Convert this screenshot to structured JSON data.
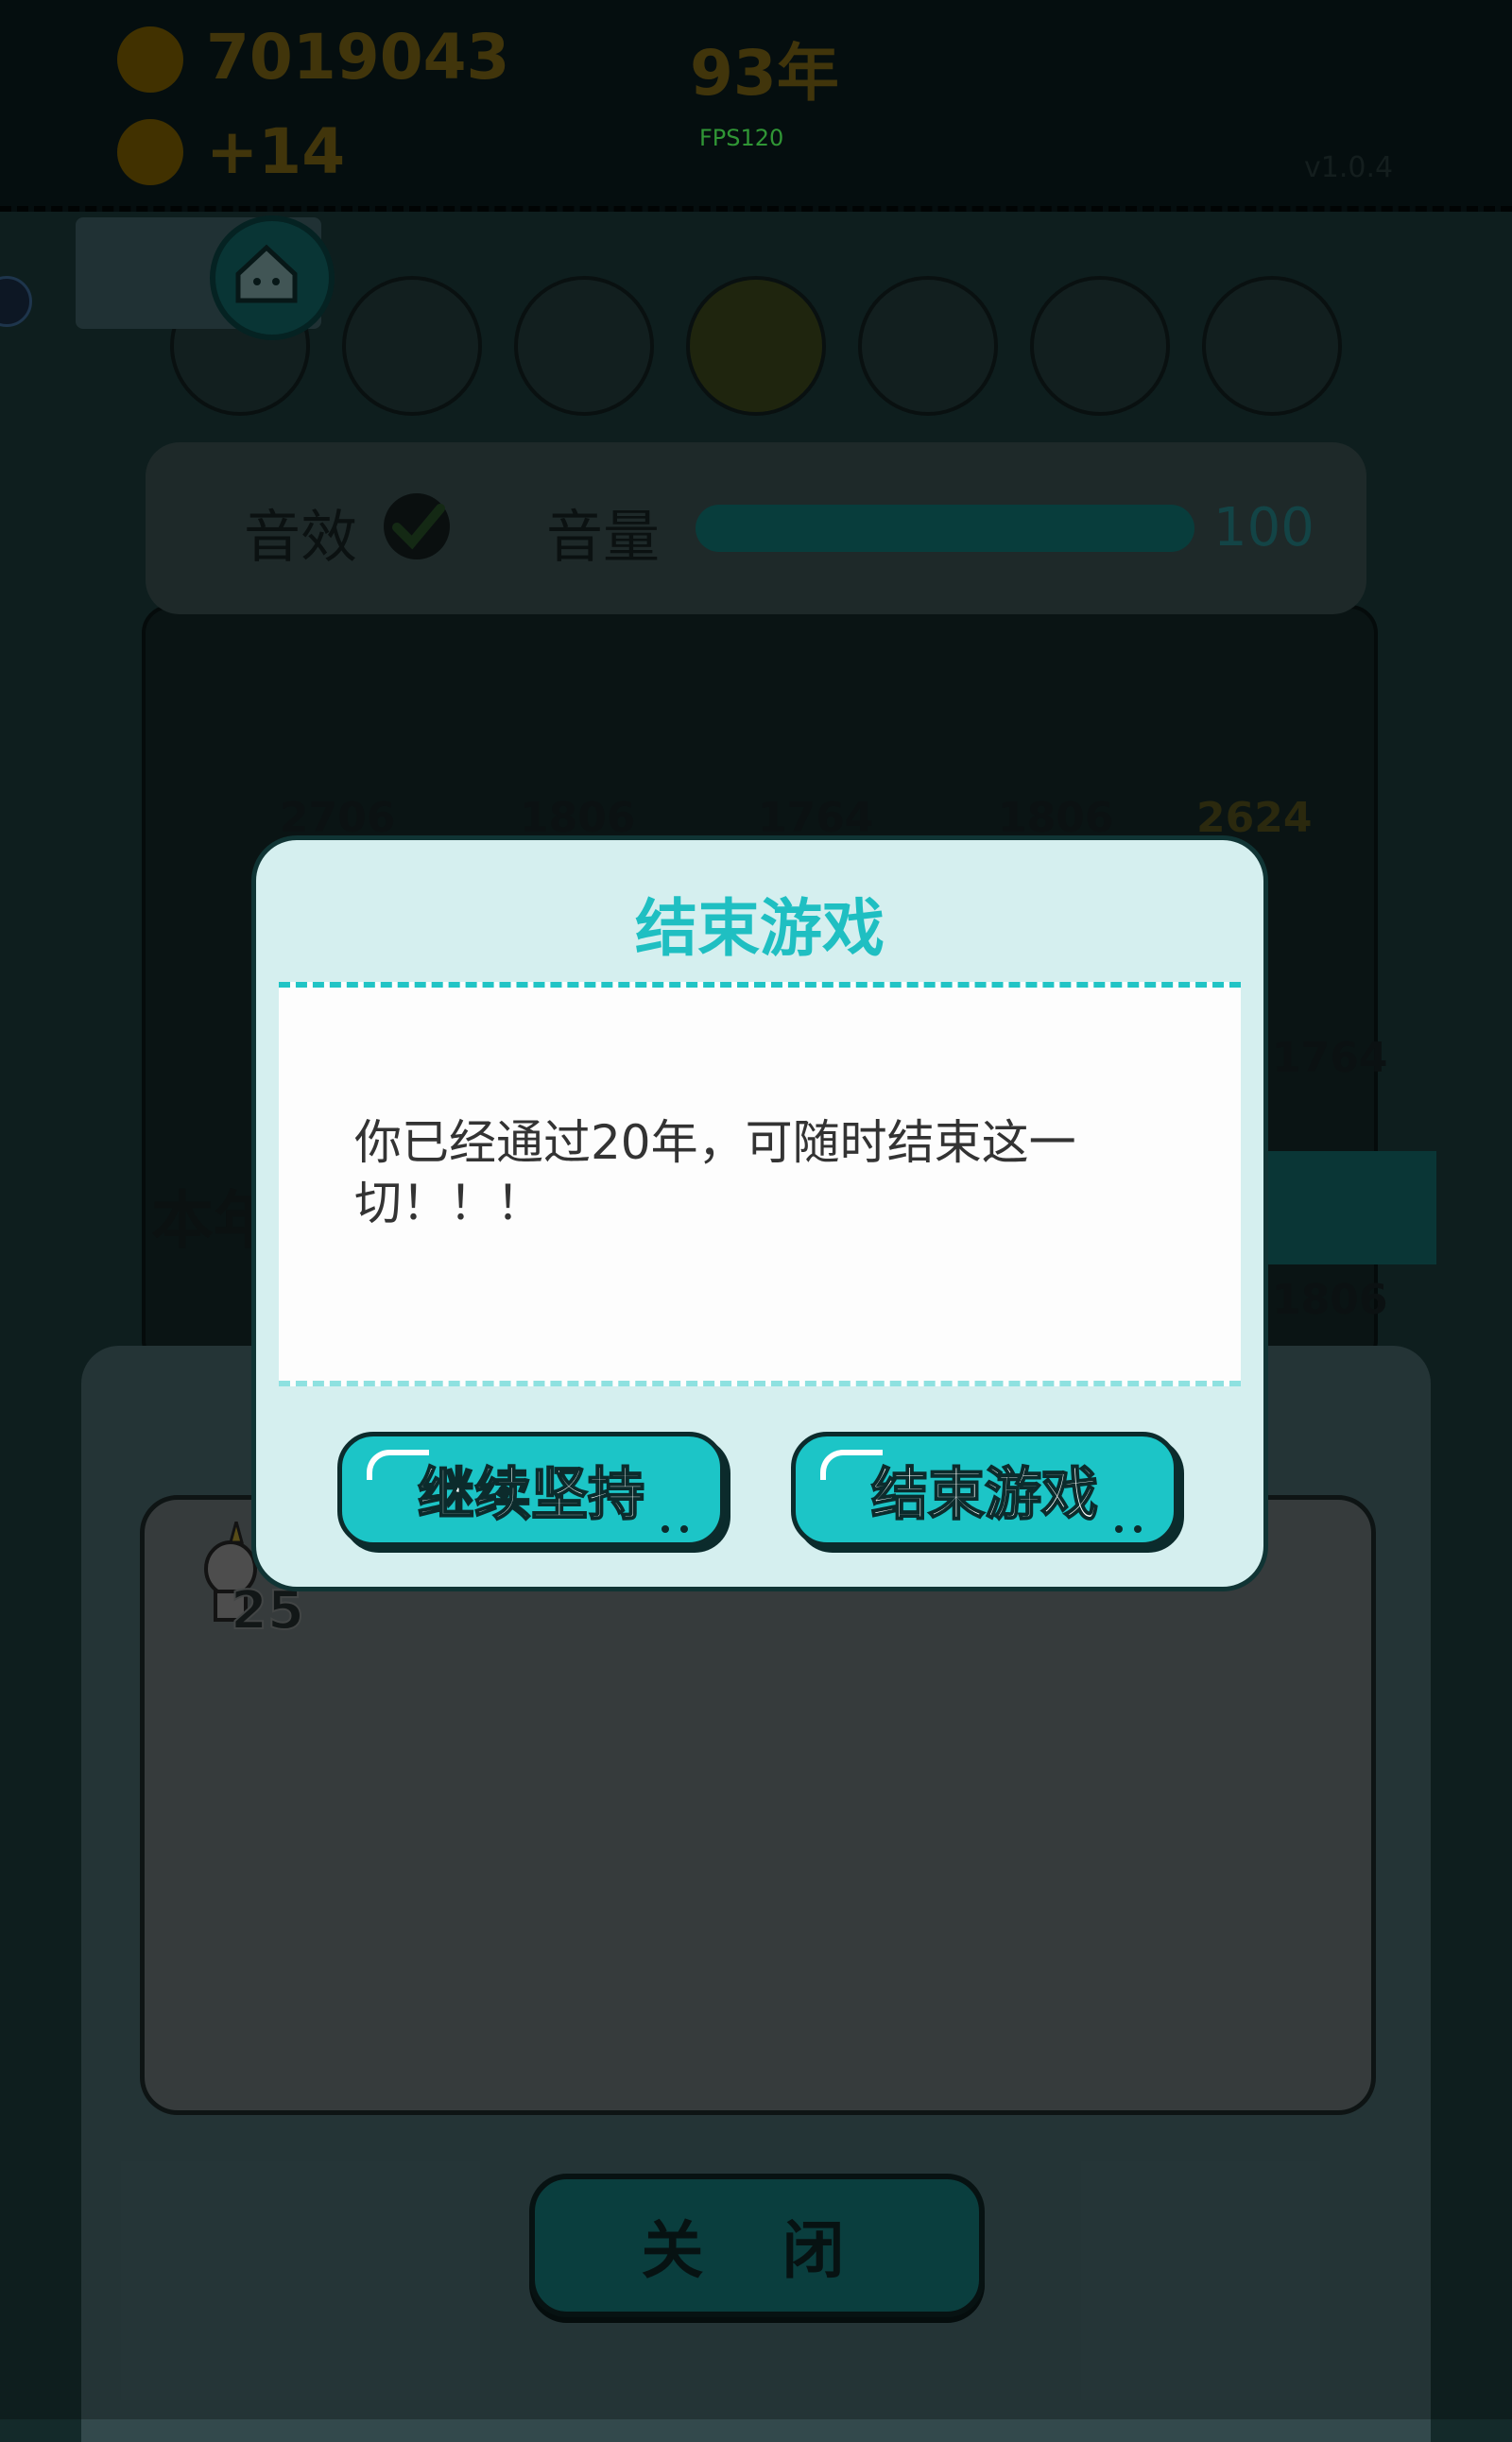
{
  "hud": {
    "coins": "7019043",
    "income": "+14",
    "year": "93年",
    "fps": "FPS120",
    "version": "v1.0.4"
  },
  "settings": {
    "sound_label": "音效",
    "sound_enabled": true,
    "volume_label": "音量",
    "volume_value": "100",
    "volume_fraction": 1.0
  },
  "board": {
    "counts": [
      "2706",
      "1806",
      "1764",
      "1806",
      "2624",
      "1764",
      "1806"
    ],
    "side_text": "本年"
  },
  "panel": {
    "inventory_count": "25",
    "close_label": "关 闭"
  },
  "dialog": {
    "title": "结束游戏",
    "message": "你已经通过20年，可随时结束这一切！！！",
    "continue_label": "继续坚持",
    "end_label": "结束游戏"
  },
  "colors": {
    "accent": "#1cc5c7",
    "dialog_bg": "#d5efef",
    "title": "#1fbfc2"
  }
}
